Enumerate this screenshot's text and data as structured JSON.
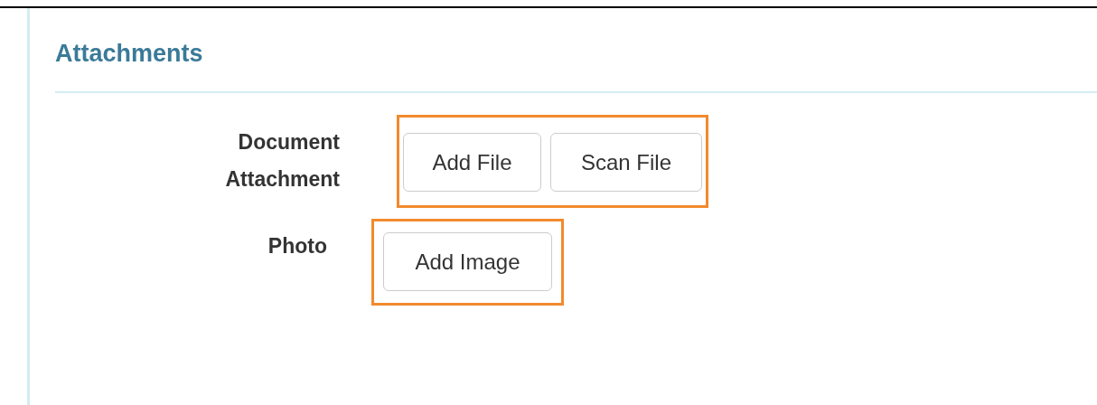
{
  "section": {
    "title": "Attachments"
  },
  "fields": [
    {
      "label": [
        "Document",
        "Attachment"
      ],
      "highlighted": true,
      "buttons": [
        "Add File",
        "Scan File"
      ]
    },
    {
      "label": [
        "Photo"
      ],
      "highlighted": true,
      "buttons": [
        "Add Image"
      ]
    }
  ]
}
